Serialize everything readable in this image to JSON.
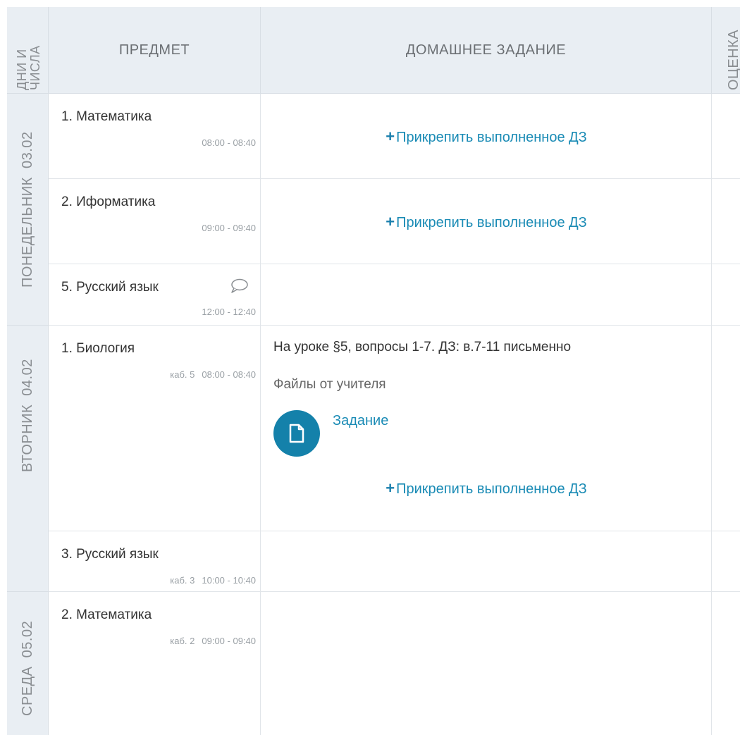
{
  "header": {
    "days_label": "ДНИ И ЧИСЛА",
    "subject_label": "ПРЕДМЕТ",
    "homework_label": "ДОМАШНЕЕ ЗАДАНИЕ",
    "mark_label": "ОЦЕНКА"
  },
  "days": [
    {
      "label": "ПОНЕДЕЛЬНИК",
      "date": "03.02"
    },
    {
      "label": "ВТОРНИК",
      "date": "04.02"
    },
    {
      "label": "СРЕДА",
      "date": "05.02"
    }
  ],
  "lessons": [
    {
      "subject": "1. Математика",
      "room": "",
      "time": "08:00 - 08:40",
      "attach": "Прикрепить выполненное ДЗ"
    },
    {
      "subject": "2. Иформатика",
      "room": "",
      "time": "09:00 - 09:40",
      "attach": "Прикрепить выполненное ДЗ"
    },
    {
      "subject": "5. Русский язык",
      "room": "",
      "time": "12:00 - 12:40"
    },
    {
      "subject": "1. Биология",
      "room": "каб. 5",
      "time": "08:00 - 08:40",
      "homework": "На уроке §5, вопросы 1-7. ДЗ: в.7-11 письменно",
      "files_label": "Файлы от учителя",
      "file_name": "Задание",
      "attach": "Прикрепить выполненное ДЗ"
    },
    {
      "subject": "3. Русский язык",
      "room": "каб. 3",
      "time": "10:00 - 10:40"
    },
    {
      "subject": "2. Математика",
      "room": "каб. 2",
      "time": "09:00 - 09:40"
    }
  ],
  "icons": {
    "plus": "plus-icon",
    "comment": "comment-icon",
    "file": "file-icon"
  },
  "colors": {
    "accent": "#1a8bb5",
    "file_circle": "#1481aa",
    "header_bg": "#e9eef3"
  }
}
